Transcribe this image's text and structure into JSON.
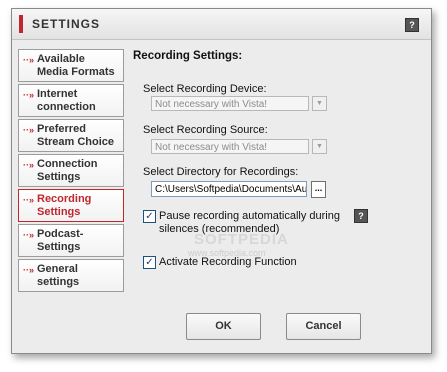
{
  "window": {
    "title": "SETTINGS",
    "help_label": "?"
  },
  "nav": {
    "items": [
      {
        "line1": "Available",
        "line2": "Media Formats",
        "active": false
      },
      {
        "line1": "Internet",
        "line2": "connection",
        "active": false
      },
      {
        "line1": "Preferred",
        "line2": "Stream Choice",
        "active": false
      },
      {
        "line1": "Connection",
        "line2": "Settings",
        "active": false
      },
      {
        "line1": "Recording",
        "line2": "Settings",
        "active": true
      },
      {
        "line1": "Podcast-",
        "line2": "Settings",
        "active": false
      },
      {
        "line1": "General",
        "line2": "settings",
        "active": false
      }
    ],
    "arrow_glyph": "··»"
  },
  "content": {
    "heading": "Recording Settings:",
    "device_label": "Select Recording Device:",
    "device_value": "Not necessary with Vista!",
    "source_label": "Select Recording Source:",
    "source_value": "Not necessary with Vista!",
    "directory_label": "Select Directory for Recordings:",
    "directory_value": "C:\\Users\\Softpedia\\Documents\\Aufn",
    "browse_label": "...",
    "pause_label_line1": "Pause recording automatically during",
    "pause_label_line2": "silences (recommended)",
    "pause_checked": true,
    "pause_help": "?",
    "activate_label": "Activate Recording Function",
    "activate_checked": true
  },
  "buttons": {
    "ok": "OK",
    "cancel": "Cancel"
  },
  "watermark": {
    "text": "SOFTPEDIA",
    "url": "www.softpedia.com"
  },
  "colors": {
    "accent": "#c0272d",
    "window_bg": "#ececec"
  }
}
